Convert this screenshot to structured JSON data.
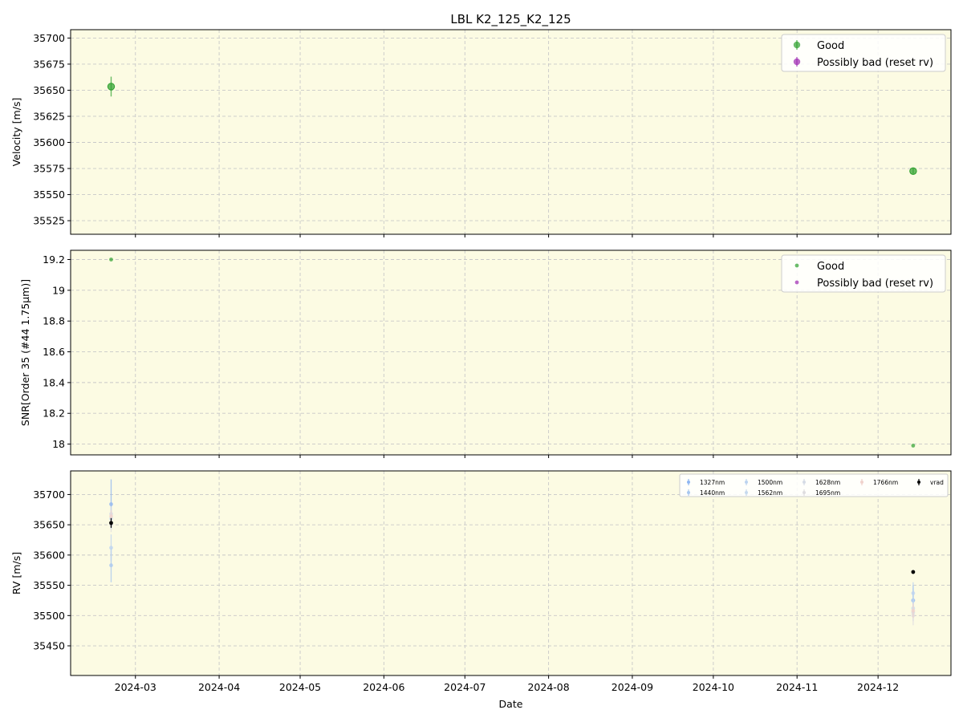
{
  "chart_data": {
    "title": "LBL K2_125_K2_125",
    "xlabel": "Date",
    "x_ticks": [
      "2024-03",
      "2024-04",
      "2024-05",
      "2024-06",
      "2024-07",
      "2024-08",
      "2024-09",
      "2024-10",
      "2024-11",
      "2024-12"
    ],
    "x_range": [
      "2024-02-06",
      "2024-12-28"
    ],
    "grid": true,
    "background_color": "#fcfbe3",
    "panels": [
      {
        "type": "scatter",
        "ylabel": "Velocity [m/s]",
        "ylim": [
          35512,
          35708
        ],
        "y_ticks": [
          35525,
          35550,
          35575,
          35600,
          35625,
          35650,
          35675,
          35700
        ],
        "legend_position": "top-right",
        "legend": [
          {
            "label": "Good",
            "color": "#2ca02c"
          },
          {
            "label": "Possibly bad (reset rv)",
            "color": "#9c27b0"
          }
        ],
        "series": [
          {
            "name": "Good",
            "color": "#2ca02c",
            "points": [
              {
                "x": "2024-02-21",
                "y": 35653.5,
                "err": 9.5
              },
              {
                "x": "2024-12-14",
                "y": 35572.5,
                "err": 2.5
              }
            ]
          },
          {
            "name": "Possibly bad (reset rv)",
            "color": "#9c27b0",
            "points": []
          }
        ]
      },
      {
        "type": "scatter",
        "ylabel": "SNR[Order 35 (#44 1.75μm)]",
        "ylim": [
          17.93,
          19.26
        ],
        "y_ticks": [
          18.0,
          18.2,
          18.4,
          18.6,
          18.8,
          19.0,
          19.2
        ],
        "legend_position": "top-right",
        "legend": [
          {
            "label": "Good",
            "color": "#2ca02c"
          },
          {
            "label": "Possibly bad (reset rv)",
            "color": "#9c27b0"
          }
        ],
        "series": [
          {
            "name": "Good",
            "color": "#2ca02c",
            "points": [
              {
                "x": "2024-02-21",
                "y": 19.2
              },
              {
                "x": "2024-12-14",
                "y": 17.99
              }
            ]
          },
          {
            "name": "Possibly bad (reset rv)",
            "color": "#9c27b0",
            "points": []
          }
        ]
      },
      {
        "type": "scatter",
        "ylabel": "RV [m/s]",
        "ylim": [
          35401,
          35739
        ],
        "y_ticks": [
          35450,
          35500,
          35550,
          35600,
          35650,
          35700
        ],
        "legend_position": "top-right",
        "legend": [
          {
            "label": "1327nm",
            "color": "#8fb6f2"
          },
          {
            "label": "1440nm",
            "color": "#a8c7f0"
          },
          {
            "label": "1500nm",
            "color": "#bcd3f0"
          },
          {
            "label": "1562nm",
            "color": "#c6d9ee"
          },
          {
            "label": "1628nm",
            "color": "#d5dbe6"
          },
          {
            "label": "1695nm",
            "color": "#dfdde0"
          },
          {
            "label": "1766nm",
            "color": "#f0d2cc"
          },
          {
            "label": "vrad",
            "color": "#000000"
          }
        ],
        "series": [
          {
            "name": "1327nm",
            "color": "#8fb6f2",
            "points": [
              {
                "x": "2024-02-21",
                "y": 35684,
                "err": 41
              },
              {
                "x": "2024-12-14",
                "y": 35525,
                "err": 25
              }
            ]
          },
          {
            "name": "1440nm",
            "color": "#a8c7f0",
            "points": [
              {
                "x": "2024-02-21",
                "y": 35583,
                "err": 28
              },
              {
                "x": "2024-12-14",
                "y": 35525,
                "err": 20
              }
            ]
          },
          {
            "name": "1500nm",
            "color": "#bcd3f0",
            "points": [
              {
                "x": "2024-02-21",
                "y": 35612,
                "err": 22
              },
              {
                "x": "2024-12-14",
                "y": 35537,
                "err": 18
              }
            ]
          },
          {
            "name": "1562nm",
            "color": "#c6d9ee",
            "points": [
              {
                "x": "2024-02-21",
                "y": 35660,
                "err": 15
              },
              {
                "x": "2024-12-14",
                "y": 35512,
                "err": 15
              }
            ]
          },
          {
            "name": "1628nm",
            "color": "#d5dbe6",
            "points": [
              {
                "x": "2024-02-21",
                "y": 35668,
                "err": 12
              },
              {
                "x": "2024-12-14",
                "y": 35505,
                "err": 14
              }
            ]
          },
          {
            "name": "1695nm",
            "color": "#dfdde0",
            "points": [
              {
                "x": "2024-02-21",
                "y": 35650,
                "err": 12
              },
              {
                "x": "2024-12-14",
                "y": 35500,
                "err": 16
              }
            ]
          },
          {
            "name": "1766nm",
            "color": "#f0d2cc",
            "points": [
              {
                "x": "2024-02-21",
                "y": 35664,
                "err": 10
              },
              {
                "x": "2024-12-14",
                "y": 35508,
                "err": 12
              }
            ]
          },
          {
            "name": "vrad",
            "color": "#000000",
            "points": [
              {
                "x": "2024-02-21",
                "y": 35653,
                "err": 8
              },
              {
                "x": "2024-12-14",
                "y": 35572,
                "err": 3
              }
            ]
          }
        ]
      }
    ]
  }
}
